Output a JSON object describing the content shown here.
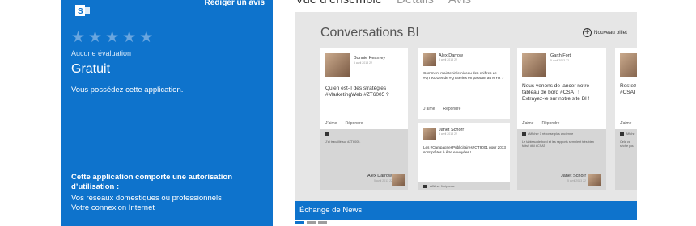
{
  "store": {
    "review_link": "Rédiger un avis",
    "stars": [
      "★",
      "★",
      "★",
      "★",
      "★"
    ],
    "rating_label": "Aucune évaluation",
    "price": "Gratuit",
    "owned": "Vous possédez cette application.",
    "permission_title": "Cette application comporte une autorisation d’utilisation :",
    "permissions": [
      "Vos réseaux domestiques ou professionnels",
      "Votre connexion Internet"
    ],
    "accent": "#0e73cc"
  },
  "tabs": [
    "Vue d’ensemble",
    "Détails",
    "Avis"
  ],
  "screenshot": {
    "title": "Conversations BI",
    "new_post": "Nouveau billet",
    "footer": "Échange de News",
    "cards": {
      "c1": {
        "name": "Bonnie Kearney",
        "date": "5 avril 2013 22",
        "text": "Qu’en est-il des stratégies #MarketingWeb #ZT6005 ?",
        "like": "J’aime",
        "reply": "Répondre",
        "reply_text": "J’ai travaillé sur #ZT6005.",
        "reply_name": "Alex Darrow",
        "reply_date": "5 avril 2013 22"
      },
      "c2": {
        "name": "Alex Darrow",
        "date": "5 avril 2013 22",
        "text": "Comment maintenir le niveau des chiffres de #QT9001 et de #QTSeries en passant au MYR ?",
        "like": "J’aime",
        "reply": "Répondre"
      },
      "c3": {
        "name": "Janet Schorr",
        "date": "5 avril 2013 22",
        "text": "Les #CampagnesPublicitaires#QT9001 pour 2013 sont prêtes à être envoyées !",
        "meta": "Afficher 1 réponse"
      },
      "c4": {
        "name": "Garth Fort",
        "date": "5 avril 2013 22",
        "text": "Nous venons de lancer notre tableau de bord #CSAT ! Extrayez-le sur notre site BI !",
        "like": "J’aime",
        "reply": "Répondre",
        "meta": "Afficher 1 réponse plus ancienne",
        "reply_text": "Le tableau de bord et les rapports semblent très bien faits ! #BI #CSAT",
        "reply_name": "Janet Schorr",
        "reply_date": "5 avril 2013 22"
      },
      "c5": {
        "text": "Restez c #CSAT et",
        "like": "J’aime",
        "meta": "Affiche",
        "reply_text": "Cela va séche pou"
      }
    }
  }
}
